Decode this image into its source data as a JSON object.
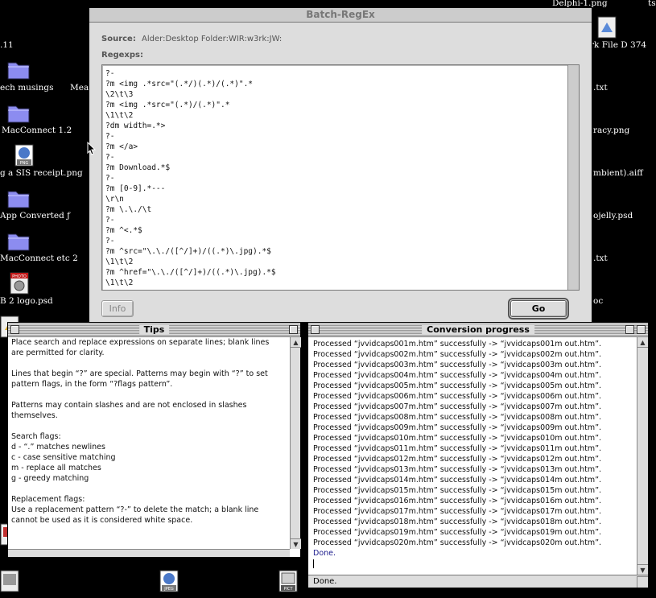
{
  "desktop": {
    "labels": [
      "Delphi-1.png",
      ".11",
      "ech musings",
      "Meas",
      "MacConnect 1.2",
      "g a SIS receipt.png",
      "App Converted ƒ",
      "MacConnect etc 2",
      "B 2 logo.psd",
      "rk File D 374",
      ".txt",
      "racy.png",
      "mbient).aiff",
      "ojelly.psd",
      ".txt",
      "oc",
      "ts"
    ],
    "icon_types": [
      "folder-icon",
      "png-file-icon",
      "photo-file-icon",
      "jpeg-file-icon",
      "pict-file-icon"
    ],
    "file_tags": {
      "png": "PNG",
      "photo": "PHOTO",
      "jpeg": "JPEG",
      "pict": "PICT"
    }
  },
  "batch": {
    "title": "Batch-RegEx",
    "source_label": "Source:",
    "source_value": "Alder:Desktop Folder:WIR:w3rk:JW:",
    "regexps_label": "Regexps:",
    "regex_lines": [
      "?-",
      "?m <img .*src=\"(.*/)(.*)/(.*)\".*",
      "\\2\\t\\3",
      "?m <img .*src=\"(.*)/(.*)\".*",
      "\\1\\t\\2",
      "?dm width=.*>",
      "?-",
      "?m </a>",
      "?-",
      "?m Download.*$",
      "?-",
      "?m [0-9].*---",
      "\\r\\n",
      "?m \\.\\./\\t",
      "?-",
      "?m ^<.*$",
      "?-",
      "?m ^src=\"\\.\\./([^/]+)/((.*)\\.jpg).*$",
      "\\1\\t\\2",
      "?m ^href=\"\\.\\./([^/]+)/((.*)\\.jpg).*$",
      "\\1\\t\\2"
    ],
    "info_button": "Info",
    "go_button": "Go"
  },
  "tips": {
    "title": "Tips",
    "paragraphs": [
      [
        "Place search and replace expressions on separate lines; blank lines",
        "are permitted for clarity."
      ],
      [
        "Lines that begin “?” are special. Patterns may begin with “?” to set",
        "pattern flags, in the form “?flags pattern”."
      ],
      [
        "Patterns may contain slashes and are not enclosed in slashes",
        "themselves."
      ],
      [
        "Search flags:",
        "d - “.” matches newlines",
        "c - case sensitive matching",
        "m - replace all matches",
        "g - greedy matching"
      ],
      [
        "Replacement flags:",
        "Use a replacement pattern “?-” to delete the match; a blank line",
        "cannot be used as it is considered white space."
      ]
    ]
  },
  "progress": {
    "title": "Conversion progress",
    "lines": [
      "Processed “jvvidcaps001m.htm” successfully -> “jvvidcaps001m out.htm”.",
      "Processed “jvvidcaps002m.htm” successfully -> “jvvidcaps002m out.htm”.",
      "Processed “jvvidcaps003m.htm” successfully -> “jvvidcaps003m out.htm”.",
      "Processed “jvvidcaps004m.htm” successfully -> “jvvidcaps004m out.htm”.",
      "Processed “jvvidcaps005m.htm” successfully -> “jvvidcaps005m out.htm”.",
      "Processed “jvvidcaps006m.htm” successfully -> “jvvidcaps006m out.htm”.",
      "Processed “jvvidcaps007m.htm” successfully -> “jvvidcaps007m out.htm”.",
      "Processed “jvvidcaps008m.htm” successfully -> “jvvidcaps008m out.htm”.",
      "Processed “jvvidcaps009m.htm” successfully -> “jvvidcaps009m out.htm”.",
      "Processed “jvvidcaps010m.htm” successfully -> “jvvidcaps010m out.htm”.",
      "Processed “jvvidcaps011m.htm” successfully -> “jvvidcaps011m out.htm”.",
      "Processed “jvvidcaps012m.htm” successfully -> “jvvidcaps012m out.htm”.",
      "Processed “jvvidcaps013m.htm” successfully -> “jvvidcaps013m out.htm”.",
      "Processed “jvvidcaps014m.htm” successfully -> “jvvidcaps014m out.htm”.",
      "Processed “jvvidcaps015m.htm” successfully -> “jvvidcaps015m out.htm”.",
      "Processed “jvvidcaps016m.htm” successfully -> “jvvidcaps016m out.htm”.",
      "Processed “jvvidcaps017m.htm” successfully -> “jvvidcaps017m out.htm”.",
      "Processed “jvvidcaps018m.htm” successfully -> “jvvidcaps018m out.htm”.",
      "Processed “jvvidcaps019m.htm” successfully -> “jvvidcaps019m out.htm”.",
      "Processed “jvvidcaps020m.htm” successfully -> “jvvidcaps020m out.htm”."
    ],
    "done_line": "Done.",
    "status": "Done.",
    "done_color": "#1a1a8c"
  }
}
